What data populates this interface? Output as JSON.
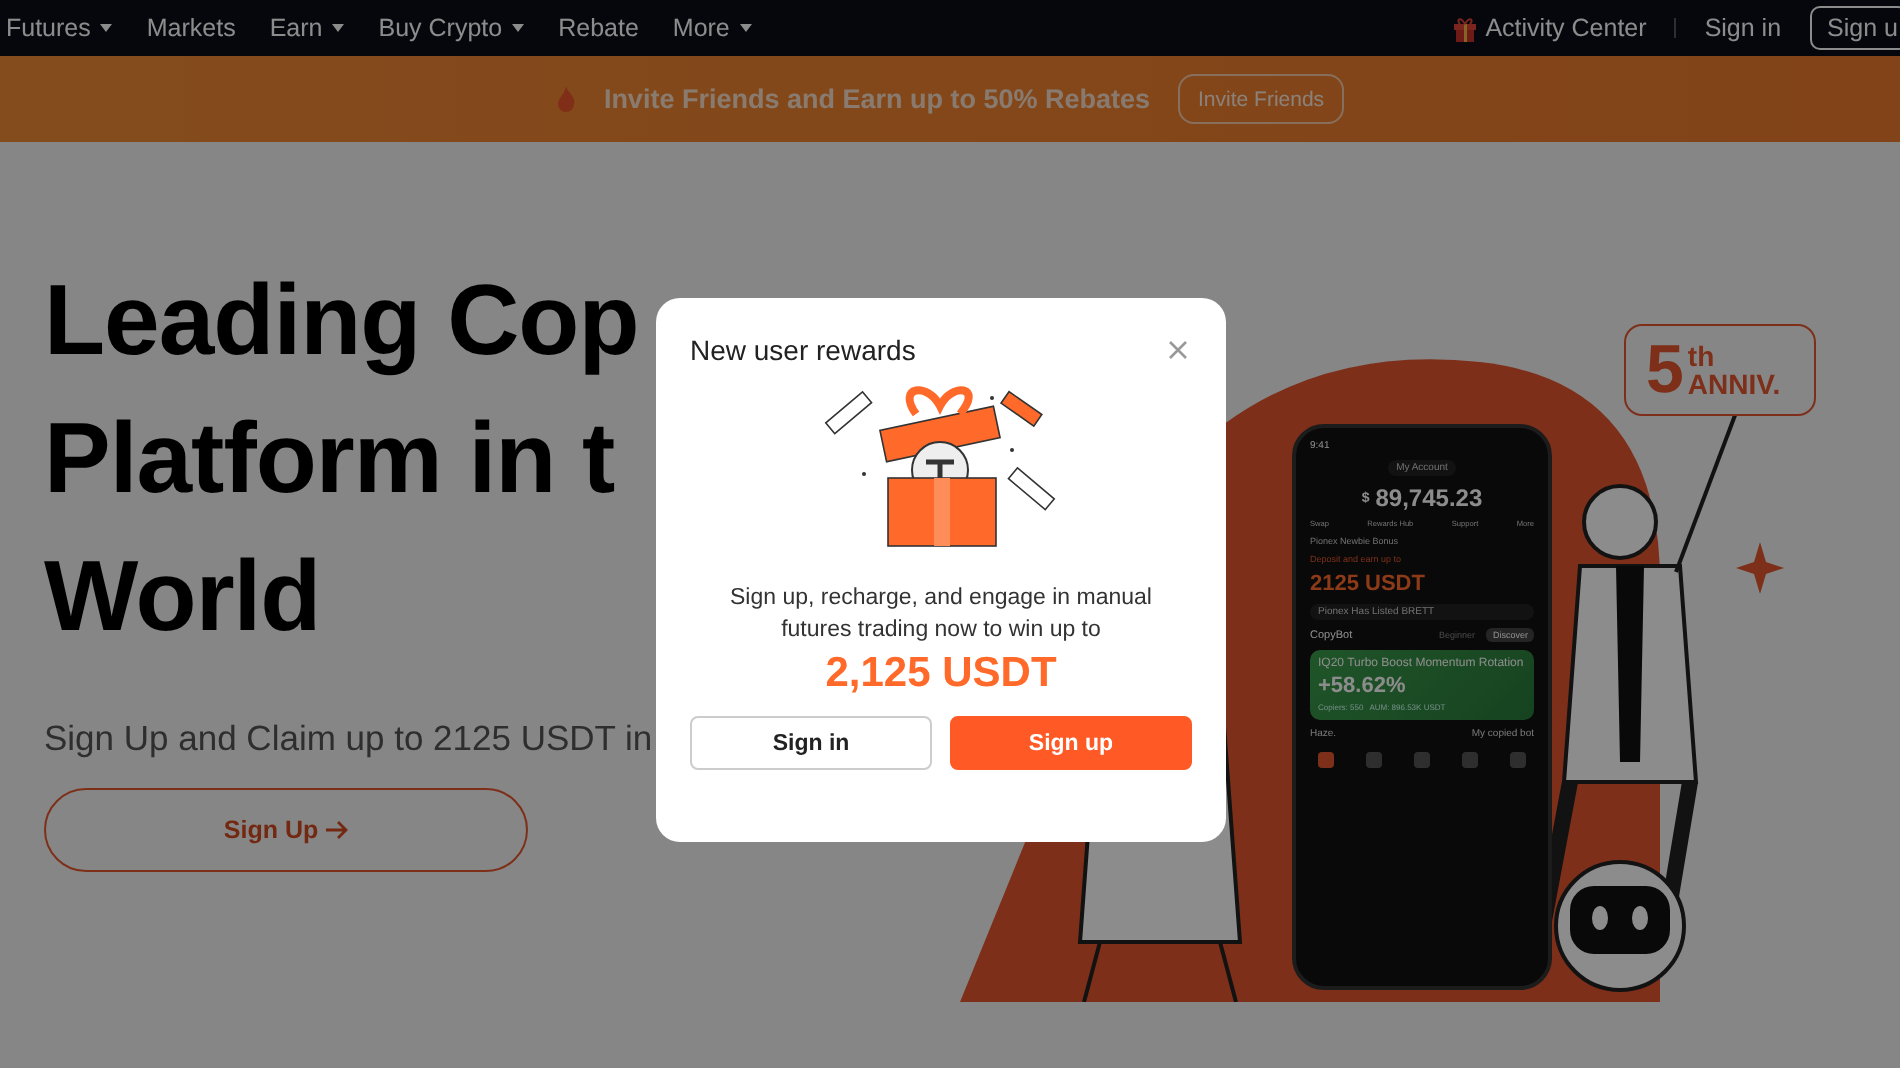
{
  "nav": {
    "items": [
      {
        "label": "Futures",
        "dropdown": true
      },
      {
        "label": "Markets",
        "dropdown": false
      },
      {
        "label": "Earn",
        "dropdown": true
      },
      {
        "label": "Buy Crypto",
        "dropdown": true
      },
      {
        "label": "Rebate",
        "dropdown": false
      },
      {
        "label": "More",
        "dropdown": true
      }
    ],
    "activity": "Activity Center",
    "sign_in": "Sign in",
    "sign_up": "Sign u"
  },
  "banner": {
    "text": "Invite Friends and Earn up to 50% Rebates",
    "button": "Invite Friends"
  },
  "hero": {
    "title_lines": [
      "Leading Cop",
      "Platform in t",
      "World"
    ],
    "subtitle": "Sign Up and Claim up to 2125 USDT in",
    "button": "Sign Up"
  },
  "illustration": {
    "badge_number": "5",
    "badge_suffix": "th",
    "badge_text": "ANNIV.",
    "phone": {
      "time": "9:41",
      "account": "My Account",
      "currency": "$",
      "balance": "89,745.23",
      "actions": [
        "Swap",
        "Rewards Hub",
        "Support",
        "More"
      ],
      "bonus_title": "Pionex Newbie Bonus",
      "bonus_sub": "Deposit and earn up to",
      "bonus_amount": "2125 USDT",
      "notice": "Pionex Has Listed BRETT",
      "section": "CopyBot",
      "tabs": [
        {
          "label": "Beginner",
          "selected": false
        },
        {
          "label": "Discover",
          "selected": true
        }
      ],
      "card_title": "IQ20 Turbo Boost Momentum Rotation",
      "card_profit": "+58.62%",
      "copiers": "Copiers: 550",
      "aum": "AUM: 896.53K USDT",
      "user": "Haze.",
      "user_action": "My copied bot",
      "bottom_tabs": [
        {
          "selected": true
        },
        {
          "selected": false
        },
        {
          "selected": false
        },
        {
          "selected": false
        },
        {
          "selected": false
        }
      ]
    }
  },
  "modal": {
    "title": "New user rewards",
    "body": "Sign up, recharge, and engage in manual futures trading now to win up to",
    "amount": "2,125 USDT",
    "buttons": [
      {
        "label": "Sign in",
        "kind": "secondary"
      },
      {
        "label": "Sign up",
        "kind": "primary"
      }
    ]
  }
}
